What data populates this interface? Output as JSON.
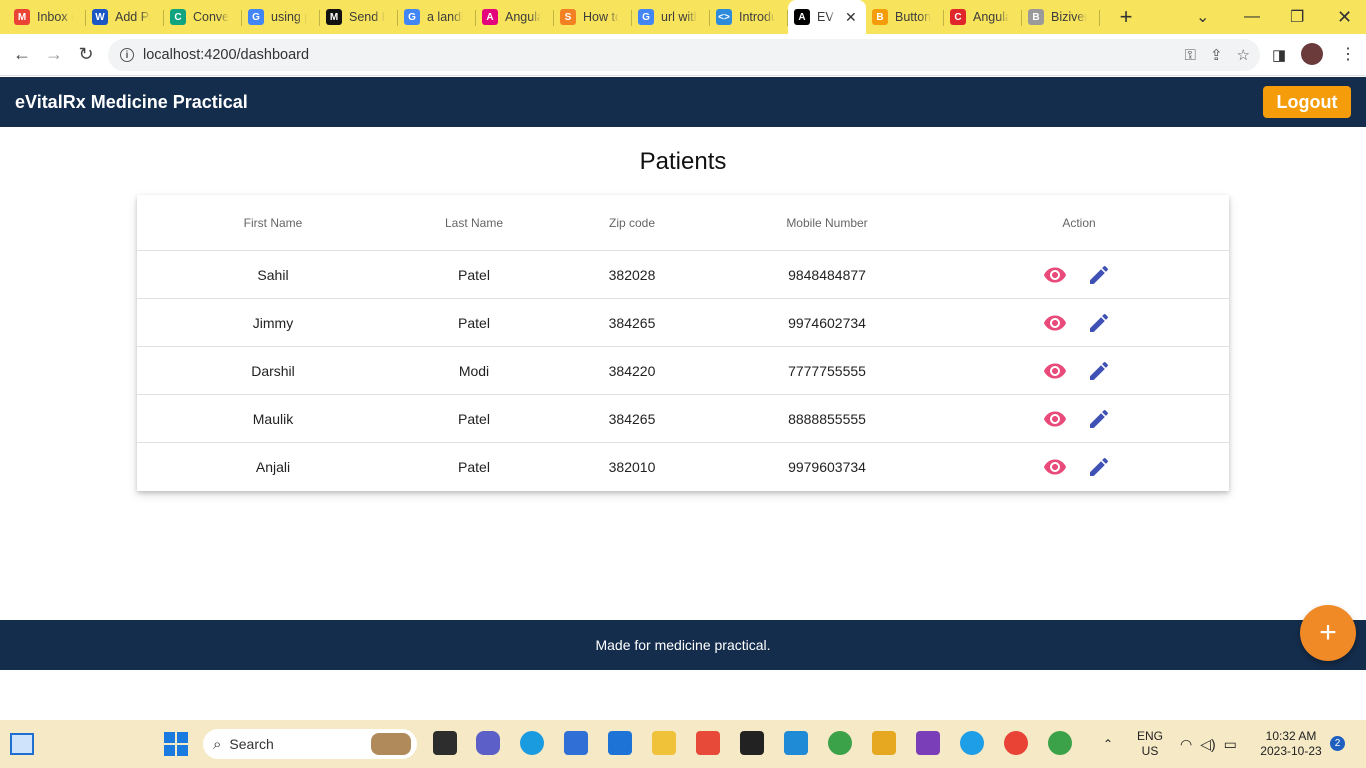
{
  "browser": {
    "tabs": [
      {
        "label": "Inbox (",
        "color": "#ea4335",
        "glyph": "M"
      },
      {
        "label": "Add Pa",
        "color": "#1a56c4",
        "glyph": "W"
      },
      {
        "label": "Conver",
        "color": "#10a37f",
        "glyph": "C"
      },
      {
        "label": "using p",
        "color": "#4285f4",
        "glyph": "G"
      },
      {
        "label": "Send H",
        "color": "#111111",
        "glyph": "M"
      },
      {
        "label": "a landi",
        "color": "#4285f4",
        "glyph": "G"
      },
      {
        "label": "Angula",
        "color": "#e4007c",
        "glyph": "A"
      },
      {
        "label": "How to",
        "color": "#f48024",
        "glyph": "S"
      },
      {
        "label": "url with",
        "color": "#4285f4",
        "glyph": "G"
      },
      {
        "label": "Introdu",
        "color": "#2e8bdc",
        "glyph": "<>"
      },
      {
        "label": "EV",
        "color": "#000000",
        "glyph": "A",
        "active": true
      },
      {
        "label": "Button",
        "color": "#f59c0b",
        "glyph": "B"
      },
      {
        "label": "Angula",
        "color": "#e0262b",
        "glyph": "C"
      },
      {
        "label": "Biziver",
        "color": "#9a9a9a",
        "glyph": "B"
      }
    ],
    "new_tab": "+",
    "address": "localhost:4200/dashboard"
  },
  "header": {
    "title": "eVitalRx Medicine Practical",
    "logout_label": "Logout"
  },
  "page": {
    "title": "Patients"
  },
  "table": {
    "columns": [
      "First Name",
      "Last Name",
      "Zip code",
      "Mobile Number",
      "Action"
    ],
    "rows": [
      {
        "first": "Sahil",
        "last": "Patel",
        "zip": "382028",
        "mobile": "9848484877"
      },
      {
        "first": "Jimmy",
        "last": "Patel",
        "zip": "384265",
        "mobile": "9974602734"
      },
      {
        "first": "Darshil",
        "last": "Modi",
        "zip": "384220",
        "mobile": "7777755555"
      },
      {
        "first": "Maulik",
        "last": "Patel",
        "zip": "384265",
        "mobile": "8888855555"
      },
      {
        "first": "Anjali",
        "last": "Patel",
        "zip": "382010",
        "mobile": "9979603734"
      }
    ],
    "view_icon": "eye-icon",
    "edit_icon": "pencil-icon"
  },
  "colors": {
    "header_bg": "#142d4c",
    "logout_bg": "#f59c0b",
    "view_icon": "#e84a7a",
    "edit_icon": "#3f51b5",
    "fab_bg": "#ef8a26"
  },
  "footer": {
    "text": "Made for medicine practical."
  },
  "fab": {
    "label": "+"
  },
  "taskbar": {
    "search_label": "Search",
    "lang_top": "ENG",
    "lang_bottom": "US",
    "time": "10:32 AM",
    "date": "2023-10-23",
    "notifications": "2"
  }
}
